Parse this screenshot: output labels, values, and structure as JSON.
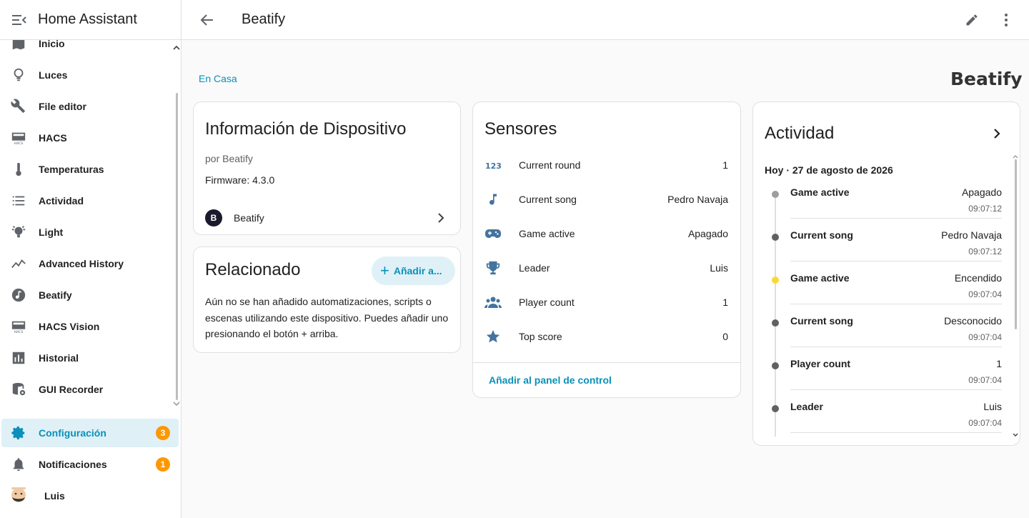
{
  "app": {
    "title": "Home Assistant"
  },
  "sidebar": {
    "items": [
      {
        "label": "Inicio",
        "icon": "map-icon"
      },
      {
        "label": "Luces",
        "icon": "lightbulb-icon"
      },
      {
        "label": "File editor",
        "icon": "wrench-icon"
      },
      {
        "label": "HACS",
        "icon": "hacs-icon"
      },
      {
        "label": "Temperaturas",
        "icon": "thermometer-icon"
      },
      {
        "label": "Actividad",
        "icon": "list-icon"
      },
      {
        "label": "Light",
        "icon": "light-group-icon"
      },
      {
        "label": "Advanced History",
        "icon": "chart-line-icon"
      },
      {
        "label": "Beatify",
        "icon": "music-circle-icon"
      },
      {
        "label": "HACS Vision",
        "icon": "hacs-icon"
      },
      {
        "label": "Historial",
        "icon": "bar-chart-icon"
      },
      {
        "label": "GUI Recorder",
        "icon": "database-icon"
      }
    ],
    "config": {
      "label": "Configuración",
      "badge": "3"
    },
    "notifications": {
      "label": "Notificaciones",
      "badge": "1"
    },
    "user": {
      "name": "Luis"
    }
  },
  "header": {
    "title": "Beatify"
  },
  "area": {
    "label": "En Casa"
  },
  "brand": {
    "logo_text": "Beatify"
  },
  "device_info": {
    "title": "Información de Dispositivo",
    "by": "por Beatify",
    "firmware": "Firmware: 4.3.0",
    "device_name": "Beatify",
    "device_logo": "B"
  },
  "related": {
    "title": "Relacionado",
    "add_label": "Añadir a...",
    "description": "Aún no se han añadido automatizaciones, scripts o escenas utilizando este dispositivo. Puedes añadir uno presionando el botón + arriba."
  },
  "sensors": {
    "title": "Sensores",
    "rows": [
      {
        "name": "Current round",
        "value": "1",
        "icon": "numeric-icon"
      },
      {
        "name": "Current song",
        "value": "Pedro Navaja",
        "icon": "music-note-icon"
      },
      {
        "name": "Game active",
        "value": "Apagado",
        "icon": "gamepad-icon"
      },
      {
        "name": "Leader",
        "value": "Luis",
        "icon": "trophy-icon"
      },
      {
        "name": "Player count",
        "value": "1",
        "icon": "account-group-icon"
      },
      {
        "name": "Top score",
        "value": "0",
        "icon": "star-icon"
      }
    ],
    "add_to_panel": "Añadir al panel de control"
  },
  "activity": {
    "title": "Actividad",
    "date": "Hoy · 27 de agosto de 2026",
    "entries": [
      {
        "name": "Game active",
        "value": "Apagado",
        "time": "09:07:12",
        "dot": "#9e9e9e"
      },
      {
        "name": "Current song",
        "value": "Pedro Navaja",
        "time": "09:07:12",
        "dot": "#616161"
      },
      {
        "name": "Game active",
        "value": "Encendido",
        "time": "09:07:04",
        "dot": "#fdd835"
      },
      {
        "name": "Current song",
        "value": "Desconocido",
        "time": "09:07:04",
        "dot": "#616161"
      },
      {
        "name": "Player count",
        "value": "1",
        "time": "09:07:04",
        "dot": "#616161"
      },
      {
        "name": "Leader",
        "value": "Luis",
        "time": "09:07:04",
        "dot": "#616161"
      }
    ]
  },
  "colors": {
    "accent": "#0b90ba",
    "badge": "#ff9800",
    "sensor_icon": "#44739e"
  }
}
